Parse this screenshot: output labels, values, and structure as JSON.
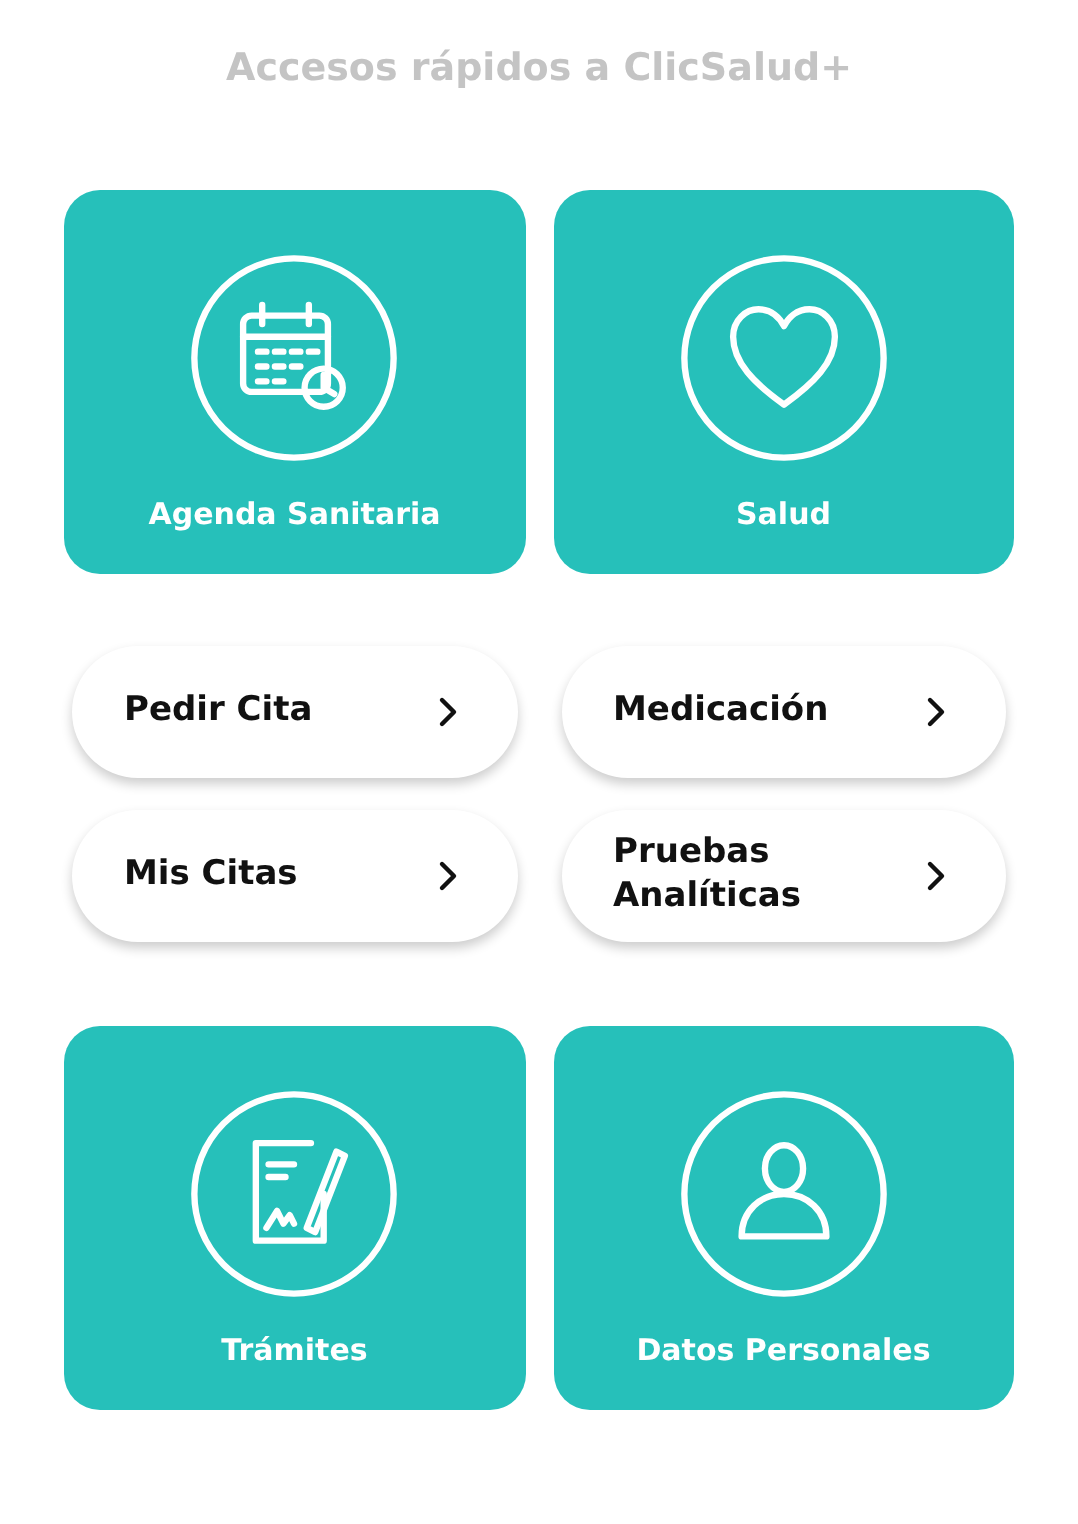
{
  "title": "Accesos rápidos a ClicSalud+",
  "top_tiles": [
    {
      "label": "Agenda Sanitaria"
    },
    {
      "label": "Salud"
    }
  ],
  "link_rows": [
    {
      "links": [
        {
          "label": "Pedir Cita"
        },
        {
          "label": "Medicación"
        }
      ]
    },
    {
      "links": [
        {
          "label": "Mis Citas"
        },
        {
          "label": "Pruebas Analíticas"
        }
      ]
    }
  ],
  "bottom_tiles": [
    {
      "label": "Trámites"
    },
    {
      "label": "Datos Personales"
    }
  ]
}
